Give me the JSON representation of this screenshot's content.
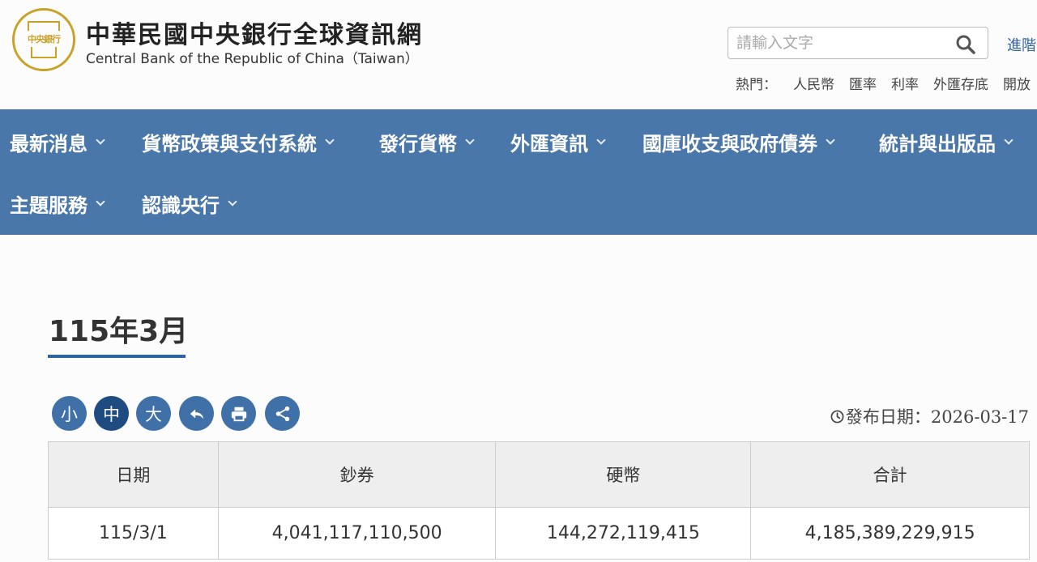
{
  "header": {
    "logo_text": "中央銀行",
    "title": "中華民國中央銀行全球資訊網",
    "subtitle": "Central Bank of the Republic of China（Taiwan）",
    "search_placeholder": "請輸入文字",
    "advanced_search": "進階",
    "hot_label": "熱門：",
    "hot_links": [
      "人民幣",
      "匯率",
      "利率",
      "外匯存底",
      "開放"
    ]
  },
  "nav": {
    "items": [
      {
        "label": "最新消息"
      },
      {
        "label": "貨幣政策與支付系統"
      },
      {
        "label": "發行貨幣"
      },
      {
        "label": "外匯資訊"
      },
      {
        "label": "國庫收支與政府債券"
      },
      {
        "label": "統計與出版品"
      },
      {
        "label": "主題服務"
      },
      {
        "label": "認識央行"
      }
    ]
  },
  "content": {
    "title": "115年3月",
    "font_small": "小",
    "font_medium": "中",
    "font_large": "大",
    "publish_date": "發布日期：2026-03-17"
  },
  "table": {
    "headers": [
      "日期",
      "鈔券",
      "硬幣",
      "合計"
    ],
    "rows": [
      [
        "115/3/1",
        "4,041,117,110,500",
        "144,272,119,415",
        "4,185,389,229,915"
      ]
    ]
  }
}
